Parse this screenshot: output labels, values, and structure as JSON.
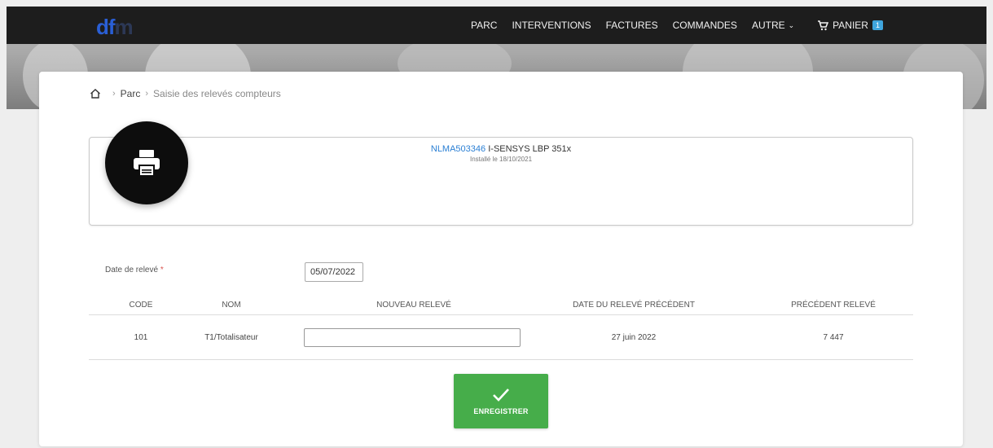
{
  "brand": {
    "logo_text_main": "df",
    "logo_text_faded": "m"
  },
  "nav": {
    "items": [
      {
        "label": "PARC"
      },
      {
        "label": "INTERVENTIONS"
      },
      {
        "label": "FACTURES"
      },
      {
        "label": "COMMANDES"
      },
      {
        "label": "AUTRE"
      }
    ],
    "cart": {
      "label": "PANIER",
      "count": "1"
    }
  },
  "breadcrumb": {
    "parc": "Parc",
    "current": "Saisie des relevés compteurs"
  },
  "device": {
    "reference": "NLMA503346",
    "model": "I-SENSYS LBP 351x",
    "installed": "Installé le 18/10/2021"
  },
  "form": {
    "date_label": "Date de relevé",
    "required_mark": "*",
    "date_value": "05/07/2022"
  },
  "table": {
    "headers": {
      "code": "CODE",
      "nom": "NOM",
      "nouveau": "NOUVEAU RELEVÉ",
      "date_prec": "DATE DU RELEVÉ PRÉCÉDENT",
      "prec": "PRÉCÉDENT RELEVÉ"
    },
    "rows": [
      {
        "code": "101",
        "nom": "T1/Totalisateur",
        "nouveau": "",
        "date_prec": "27 juin 2022",
        "prec": "7 447"
      }
    ]
  },
  "actions": {
    "save_label": "ENREGISTRER"
  },
  "colors": {
    "accent_green": "#46ad4a",
    "link_blue": "#2a7fd4",
    "badge_blue": "#3fa5dd"
  }
}
